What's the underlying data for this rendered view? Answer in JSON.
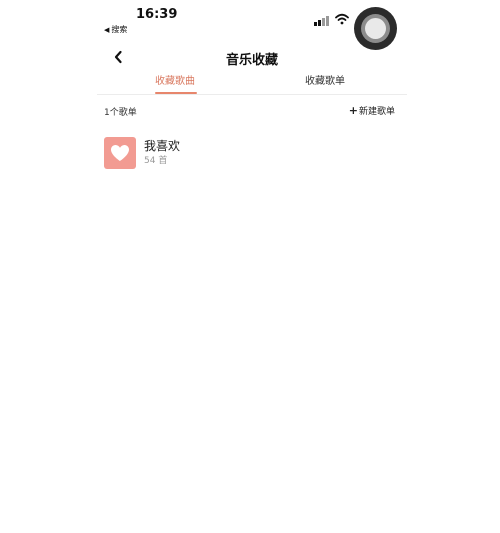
{
  "status_bar": {
    "time": "16:39",
    "back_app": "搜索"
  },
  "nav": {
    "title": "音乐收藏"
  },
  "tabs": [
    {
      "label": "收藏歌曲",
      "active": true
    },
    {
      "label": "收藏歌单",
      "active": false
    }
  ],
  "list": {
    "count_label": "1个歌单",
    "new_playlist_label": "新建歌单"
  },
  "playlists": [
    {
      "name": "我喜欢",
      "count": "54 首",
      "icon": "heart-icon"
    }
  ],
  "colors": {
    "accent": "#e7866c",
    "cover": "#f29b92"
  }
}
